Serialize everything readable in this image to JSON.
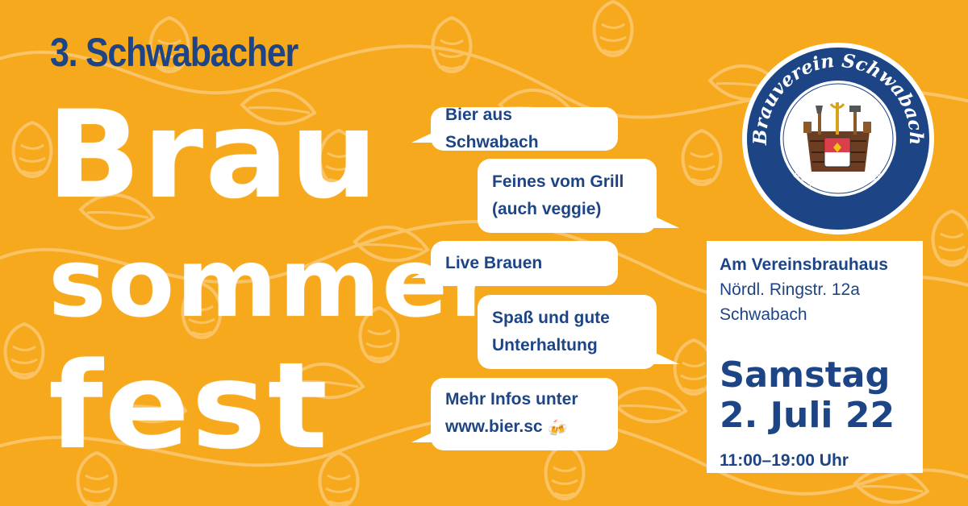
{
  "poster": {
    "subtitle": "3. Schwabacher",
    "headline": [
      "Brau",
      "sommer",
      "fest"
    ],
    "colors": {
      "background": "#f7a91d",
      "pattern": "#fbc56a",
      "accent": "#1d4586",
      "white": "#ffffff"
    }
  },
  "bubbles": {
    "b1": "Bier aus Schwabach",
    "b2_line1": "Feines vom Grill",
    "b2_line2": "(auch veggie)",
    "b3": "Live Brauen",
    "b4_line1": "Spaß und gute",
    "b4_line2": "Unterhaltung",
    "b5_line1": "Mehr Infos unter",
    "b5_line2": "www.bier.sc",
    "b5_icon": "beer-mugs-icon"
  },
  "info": {
    "venue_name": "Am Vereinsbrauhaus",
    "street": "Nördl. Ringstr. 12a",
    "city": "Schwabach",
    "day": "Samstag",
    "date": "2. Juli 22",
    "time": "11:00–19:00 Uhr"
  },
  "seal": {
    "name": "Brauverein Schwabach",
    "founded": "gegründet 2020",
    "icon": "brewery-crest-icon"
  }
}
